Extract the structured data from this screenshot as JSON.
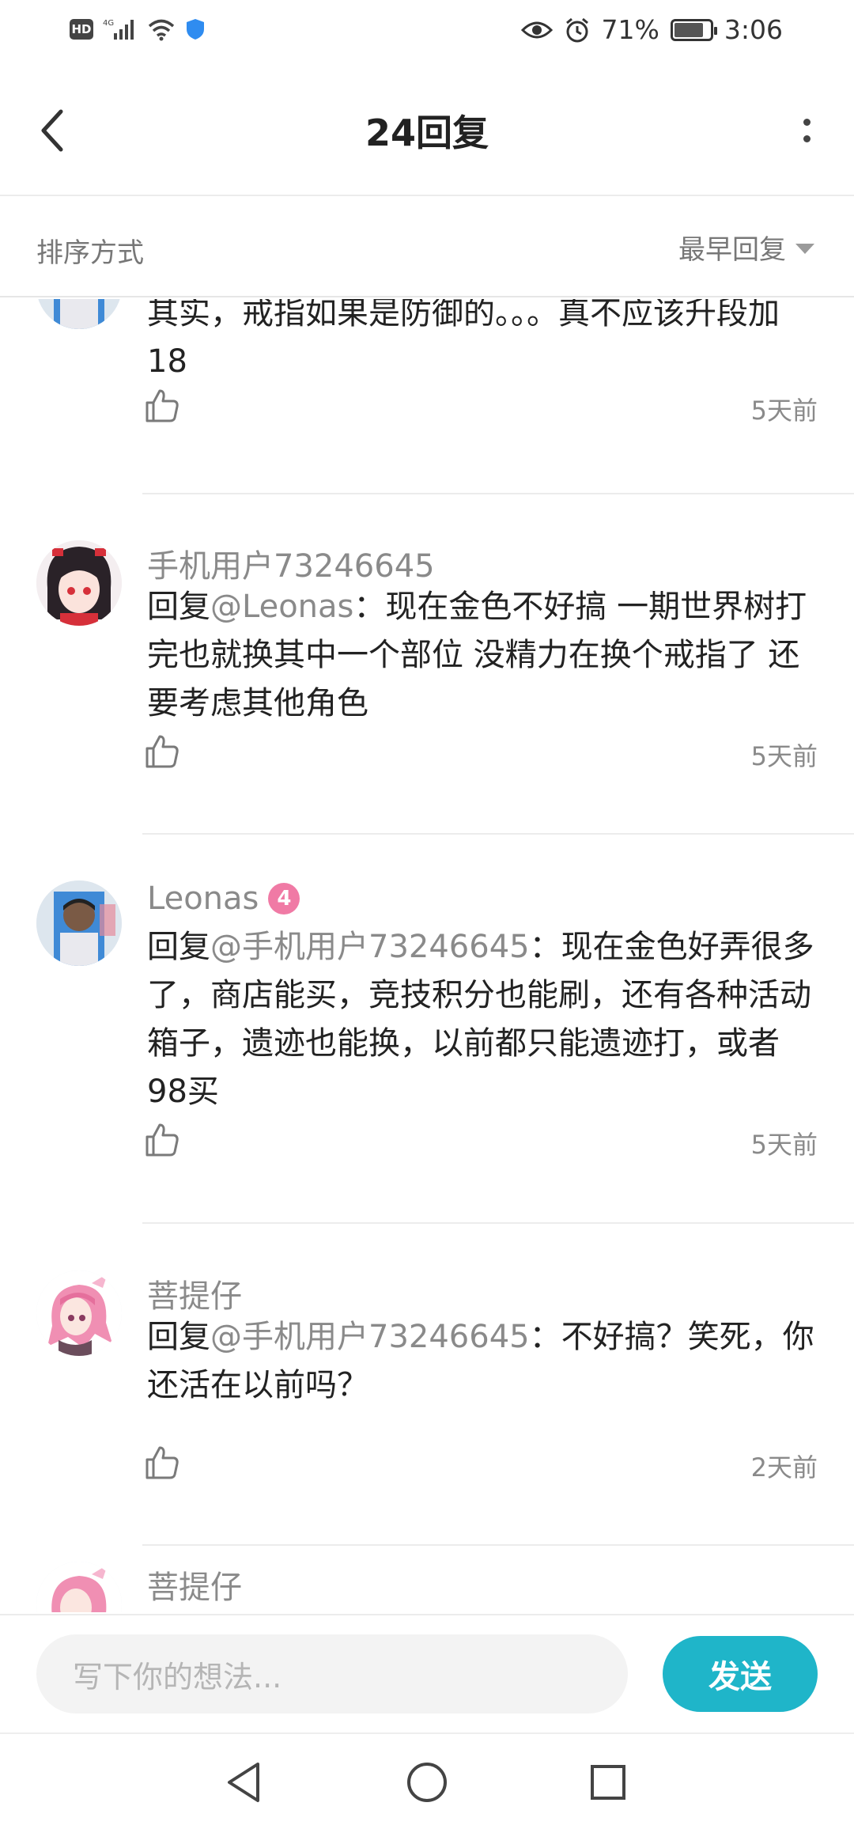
{
  "status_bar": {
    "hd": "HD",
    "network": "4G",
    "battery": "71%",
    "time": "3:06"
  },
  "header": {
    "title": "24回复"
  },
  "sort": {
    "label": "排序方式",
    "selected": "最早回复"
  },
  "comments": [
    {
      "username": "",
      "text": "其实，戒指如果是防御的。。。真不应该升段加18",
      "time": "5天前"
    },
    {
      "username": "手机用户73246645",
      "reply_prefix": "回复",
      "mention": "@Leonas",
      "text": "：现在金色不好搞 一期世界树打完也就换其中一个部位  没精力在换个戒指了 还要考虑其他角色",
      "time": "5天前"
    },
    {
      "username": "Leonas",
      "level": "4",
      "reply_prefix": "回复",
      "mention": "@手机用户73246645",
      "text": "：现在金色好弄很多了，商店能买，竞技积分也能刷，还有各种活动箱子，遗迹也能换，以前都只能遗迹打，或者98买",
      "time": "5天前"
    },
    {
      "username": "菩提仔",
      "reply_prefix": "回复",
      "mention": "@手机用户73246645",
      "text": "：不好搞？笑死，你还活在以前吗？",
      "time": "2天前"
    },
    {
      "username": "菩提仔"
    }
  ],
  "input": {
    "placeholder": "写下你的想法..."
  },
  "send": {
    "label": "发送"
  },
  "colors": {
    "accent": "#1fb5c9",
    "level_badge": "#f07aa5",
    "muted_text": "#8a8a8a"
  }
}
